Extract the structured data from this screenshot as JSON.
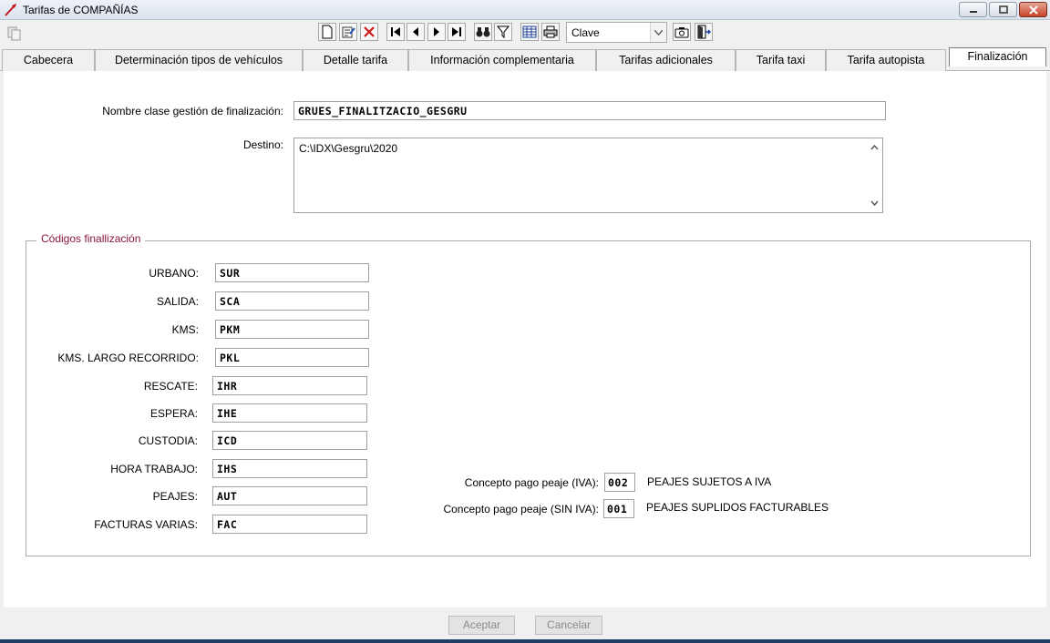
{
  "window": {
    "title": "Tarifas de COMPAÑÍAS"
  },
  "toolbar": {
    "combo_value": "Clave"
  },
  "tabs": [
    {
      "label": "Cabecera"
    },
    {
      "label": "Determinación tipos de vehículos"
    },
    {
      "label": "Detalle tarifa"
    },
    {
      "label": "Información complementaria"
    },
    {
      "label": "Tarifas adicionales"
    },
    {
      "label": "Tarifa taxi"
    },
    {
      "label": "Tarifa autopista"
    },
    {
      "label": "Finalización"
    }
  ],
  "form": {
    "clase_label": "Nombre clase gestión de finalización:",
    "clase_value": "GRUES_FINALITZACIO_GESGRU",
    "destino_label": "Destino:",
    "destino_value": "C:\\IDX\\Gesgru\\2020"
  },
  "codigos": {
    "legend": "Códigos finallización",
    "rows": [
      {
        "label": "URBANO:",
        "value": "SUR"
      },
      {
        "label": "SALIDA:",
        "value": "SCA"
      },
      {
        "label": "KMS:",
        "value": "PKM"
      },
      {
        "label": "KMS. LARGO RECORRIDO:",
        "value": "PKL"
      },
      {
        "label": "RESCATE:",
        "value": "IHR"
      },
      {
        "label": "ESPERA:",
        "value": "IHE"
      },
      {
        "label": "CUSTODIA:",
        "value": "ICD"
      },
      {
        "label": "HORA TRABAJO:",
        "value": "IHS"
      },
      {
        "label": "PEAJES:",
        "value": "AUT"
      },
      {
        "label": "FACTURAS VARIAS:",
        "value": "FAC"
      }
    ],
    "peaje_iva": {
      "label": "Concepto pago peaje (IVA):",
      "value": "002",
      "desc": "PEAJES SUJETOS A IVA"
    },
    "peaje_sin_iva": {
      "label": "Concepto pago peaje (SIN IVA):",
      "value": "001",
      "desc": "PEAJES SUPLIDOS FACTURABLES"
    }
  },
  "buttons": {
    "accept": "Aceptar",
    "cancel": "Cancelar"
  }
}
